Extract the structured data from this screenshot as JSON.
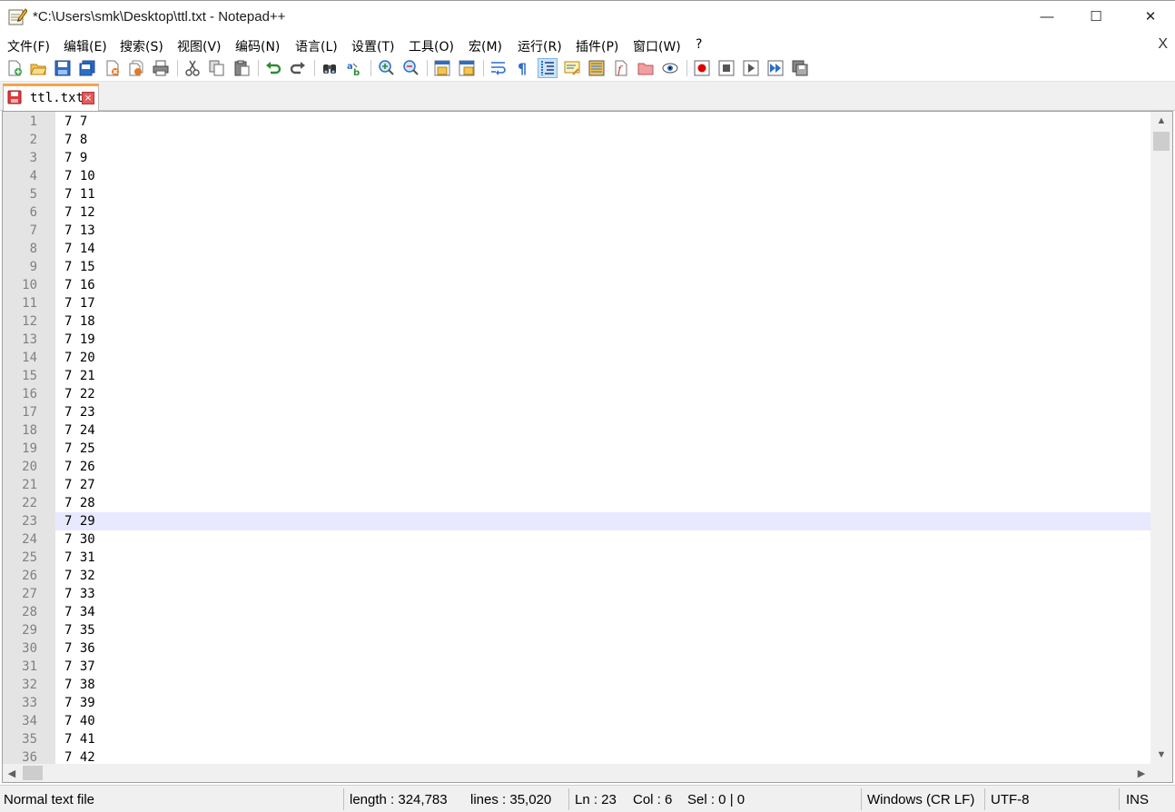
{
  "window": {
    "title": "*C:\\Users\\smk\\Desktop\\ttl.txt - Notepad++",
    "minimize": "—",
    "maximize": "☐",
    "close": "✕"
  },
  "menu": {
    "items": [
      "文件(F)",
      "编辑(E)",
      "搜索(S)",
      "视图(V)",
      "编码(N)",
      "语言(L)",
      "设置(T)",
      "工具(O)",
      "宏(M)",
      "运行(R)",
      "插件(P)",
      "窗口(W)",
      "?"
    ],
    "close_label": "X"
  },
  "toolbar": {
    "buttons": [
      "new-file-icon",
      "open-file-icon",
      "save-icon",
      "save-all-icon",
      "close-icon",
      "close-all-icon",
      "print-icon",
      "cut-icon",
      "copy-icon",
      "paste-icon",
      "undo-icon",
      "redo-icon",
      "find-icon",
      "replace-icon",
      "zoom-in-icon",
      "zoom-out-icon",
      "sync-vertical-icon",
      "sync-horizontal-icon",
      "word-wrap-icon",
      "show-all-characters-icon",
      "indent-guide-icon",
      "user-defined-language-icon",
      "document-map-icon",
      "function-list-icon",
      "folder-as-workspace-icon",
      "monitoring-icon",
      "macro-record-icon",
      "macro-stop-icon",
      "macro-play-icon",
      "macro-run-multiple-icon",
      "macro-save-icon"
    ],
    "active_button": "indent-guide-icon"
  },
  "tabs": [
    {
      "label": "ttl.txt",
      "modified": true,
      "close": "×"
    }
  ],
  "editor": {
    "current_line": 23,
    "line_numbers": [
      "1",
      "2",
      "3",
      "4",
      "5",
      "6",
      "7",
      "8",
      "9",
      "10",
      "11",
      "12",
      "13",
      "14",
      "15",
      "16",
      "17",
      "18",
      "19",
      "20",
      "21",
      "22",
      "23",
      "24",
      "25",
      "26",
      "27",
      "28",
      "29",
      "30",
      "31",
      "32",
      "33",
      "34",
      "35",
      "36"
    ],
    "lines": [
      "7 7",
      "7 8",
      "7 9",
      "7 10",
      "7 11",
      "7 12",
      "7 13",
      "7 14",
      "7 15",
      "7 16",
      "7 17",
      "7 18",
      "7 19",
      "7 20",
      "7 21",
      "7 22",
      "7 23",
      "7 24",
      "7 25",
      "7 26",
      "7 27",
      "7 28",
      "7 29",
      "7 30",
      "7 31",
      "7 32",
      "7 33",
      "7 34",
      "7 35",
      "7 36",
      "7 37",
      "7 38",
      "7 39",
      "7 40",
      "7 41",
      "7 42"
    ]
  },
  "scrollbars": {
    "up": "▲",
    "down": "▼",
    "left": "◀",
    "right": "▶"
  },
  "status": {
    "file_type": "Normal text file",
    "length": "length : 324,783",
    "lines": "lines : 35,020",
    "ln": "Ln : 23",
    "col": "Col : 6",
    "sel": "Sel : 0 | 0",
    "eol": "Windows (CR LF)",
    "encoding": "UTF-8",
    "mode": "INS"
  }
}
